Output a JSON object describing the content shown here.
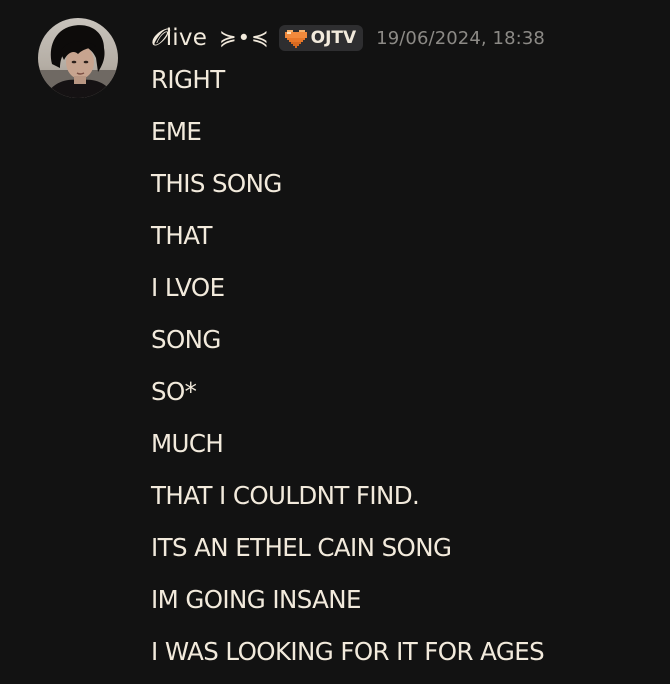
{
  "message": {
    "author": {
      "display_name_prefix": "𝓞",
      "display_name_rest": "live",
      "kaomoji": "≽•≼",
      "tag": {
        "icon": "orange-pixel-heart-icon",
        "label": "OJTV"
      },
      "avatar": "profile-photo-avatar"
    },
    "timestamp": "19/06/2024, 18:38",
    "lines": [
      "RIGHT",
      "EME",
      "THIS SONG",
      "THAT",
      "I LVOE",
      "SONG",
      "SO*",
      "MUCH",
      "THAT I COULDNT FIND.",
      "ITS AN ETHEL CAIN SONG",
      "IM GOING INSANE",
      "I WAS LOOKING FOR IT FOR AGES"
    ]
  },
  "colors": {
    "background": "#121212",
    "text": "#f2eadc",
    "timestamp": "#8c8a86",
    "tag_background": "#2e2e30",
    "tag_heart": "#f28a3c"
  }
}
